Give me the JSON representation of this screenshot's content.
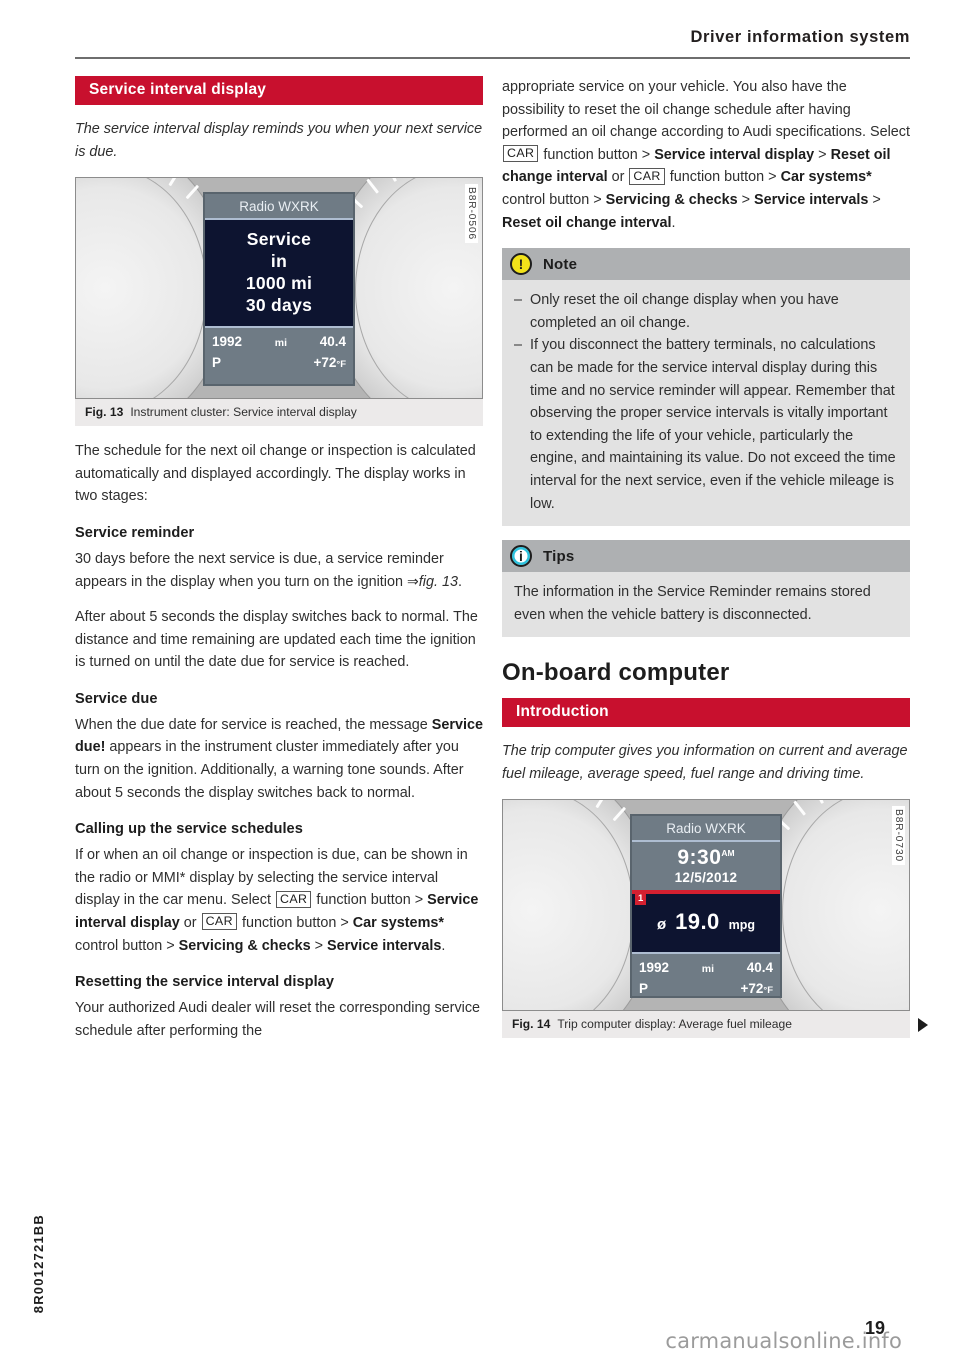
{
  "header": {
    "running_head": "Driver information system"
  },
  "left_column": {
    "section_title": "Service interval display",
    "lead": "The service interval display reminds you when your next service is due.",
    "figure13": {
      "code": "B8R-0506",
      "caption_number": "Fig. 13",
      "caption_text": "Instrument cluster: Service interval display",
      "screen": {
        "title": "Radio WXRK",
        "lines": [
          "Service",
          "in",
          "1000 mi",
          "30 days"
        ],
        "odometer": "1992",
        "odometer_unit": "mi",
        "range": "40.4",
        "gear": "P",
        "temperature": "+72",
        "temperature_unit": "°F"
      }
    },
    "para1": "The schedule for the next oil change or inspection is calculated automatically and displayed accordingly. The display works in two stages:",
    "heading_service_reminder": "Service reminder",
    "para2_a": "30 days before the next service is due, a service reminder appears in the display when you turn on the ignition ",
    "para2_ref": "fig. 13",
    "para2_end": ".",
    "para3": "After about 5 seconds the display switches back to normal. The distance and time remaining are updated each time the ignition is turned on until the date due for service is reached.",
    "heading_service_due": "Service due",
    "para4_a": "When the due date for service is reached, the message ",
    "para4_bold": "Service due!",
    "para4_b": " appears in the instrument cluster immediately after you turn on the ignition. Additionally, a warning tone sounds. After about 5 seconds the display switches back to normal.",
    "heading_calling_up": "Calling up the service schedules",
    "para5_a": "If or when an oil change or inspection is due, can be shown in the radio or MMI* display by selecting the service interval display in the car menu. Select ",
    "key_car": "CAR",
    "para5_b": " function button > ",
    "para5_bold1": "Service interval display",
    "para5_c": " or ",
    "para5_d": " function button > ",
    "para5_bold2": "Car systems*",
    "para5_e": " control button > ",
    "para5_bold3": "Servicing & checks",
    "para5_f": " > ",
    "para5_bold4": "Service intervals",
    "para5_g": ".",
    "heading_resetting": "Resetting the service interval display",
    "para6": "Your authorized Audi dealer will reset the corresponding service schedule after performing the"
  },
  "right_column": {
    "para_top_a": "appropriate service on your vehicle. You also have the possibility to reset the oil change schedule after having performed an oil change according to Audi specifications. Select ",
    "key_car": "CAR",
    "para_top_b": " function button > ",
    "para_top_bold1": "Service interval display",
    "para_top_c": " > ",
    "para_top_bold2": "Reset oil change interval",
    "para_top_d": " or ",
    "para_top_e": " function button > ",
    "para_top_bold3": "Car systems*",
    "para_top_f": " control button > ",
    "para_top_bold4": "Servicing & checks",
    "para_top_g": " > ",
    "para_top_bold5": "Service intervals",
    "para_top_h": " > ",
    "para_top_bold6": "Reset oil change interval",
    "para_top_i": ".",
    "note": {
      "title": "Note",
      "items": [
        "Only reset the oil change display when you have completed an oil change.",
        "If you disconnect the battery terminals, no calculations can be made for the service interval display during this time and no service reminder will appear. Remember that observing the proper service intervals is vitally important to extending the life of your vehicle, particularly the engine, and maintaining its value. Do not exceed the time interval for the next service, even if the vehicle mileage is low."
      ]
    },
    "tips": {
      "title": "Tips",
      "body": "The information in the Service Reminder remains stored even when the vehicle battery is disconnected."
    },
    "chapter_title": "On-board computer",
    "section_title": "Introduction",
    "lead": "The trip computer gives you information on current and average fuel mileage, average speed, fuel range and driving time.",
    "figure14": {
      "code": "B8R-0730",
      "caption_number": "Fig. 14",
      "caption_text": "Trip computer display: Average fuel mileage",
      "screen": {
        "title": "Radio WXRK",
        "time": "9:30",
        "time_suffix": "AM",
        "date": "12/5/2012",
        "badge": "1",
        "avg_symbol": "ø",
        "avg_value": "19.0",
        "avg_unit": "mpg",
        "odometer": "1992",
        "odometer_unit": "mi",
        "range": "40.4",
        "gear": "P",
        "temperature": "+72",
        "temperature_unit": "°F"
      }
    }
  },
  "footer": {
    "spine_code": "8R0012721BB",
    "page_number": "19",
    "watermark": "carmanualsonline.info"
  },
  "colors": {
    "accent_red": "#c8102e",
    "callout_header": "#aeb0b2",
    "callout_body": "#e2e2e2",
    "note_icon": "#f2e21a",
    "tip_icon": "#2ec2dd"
  }
}
